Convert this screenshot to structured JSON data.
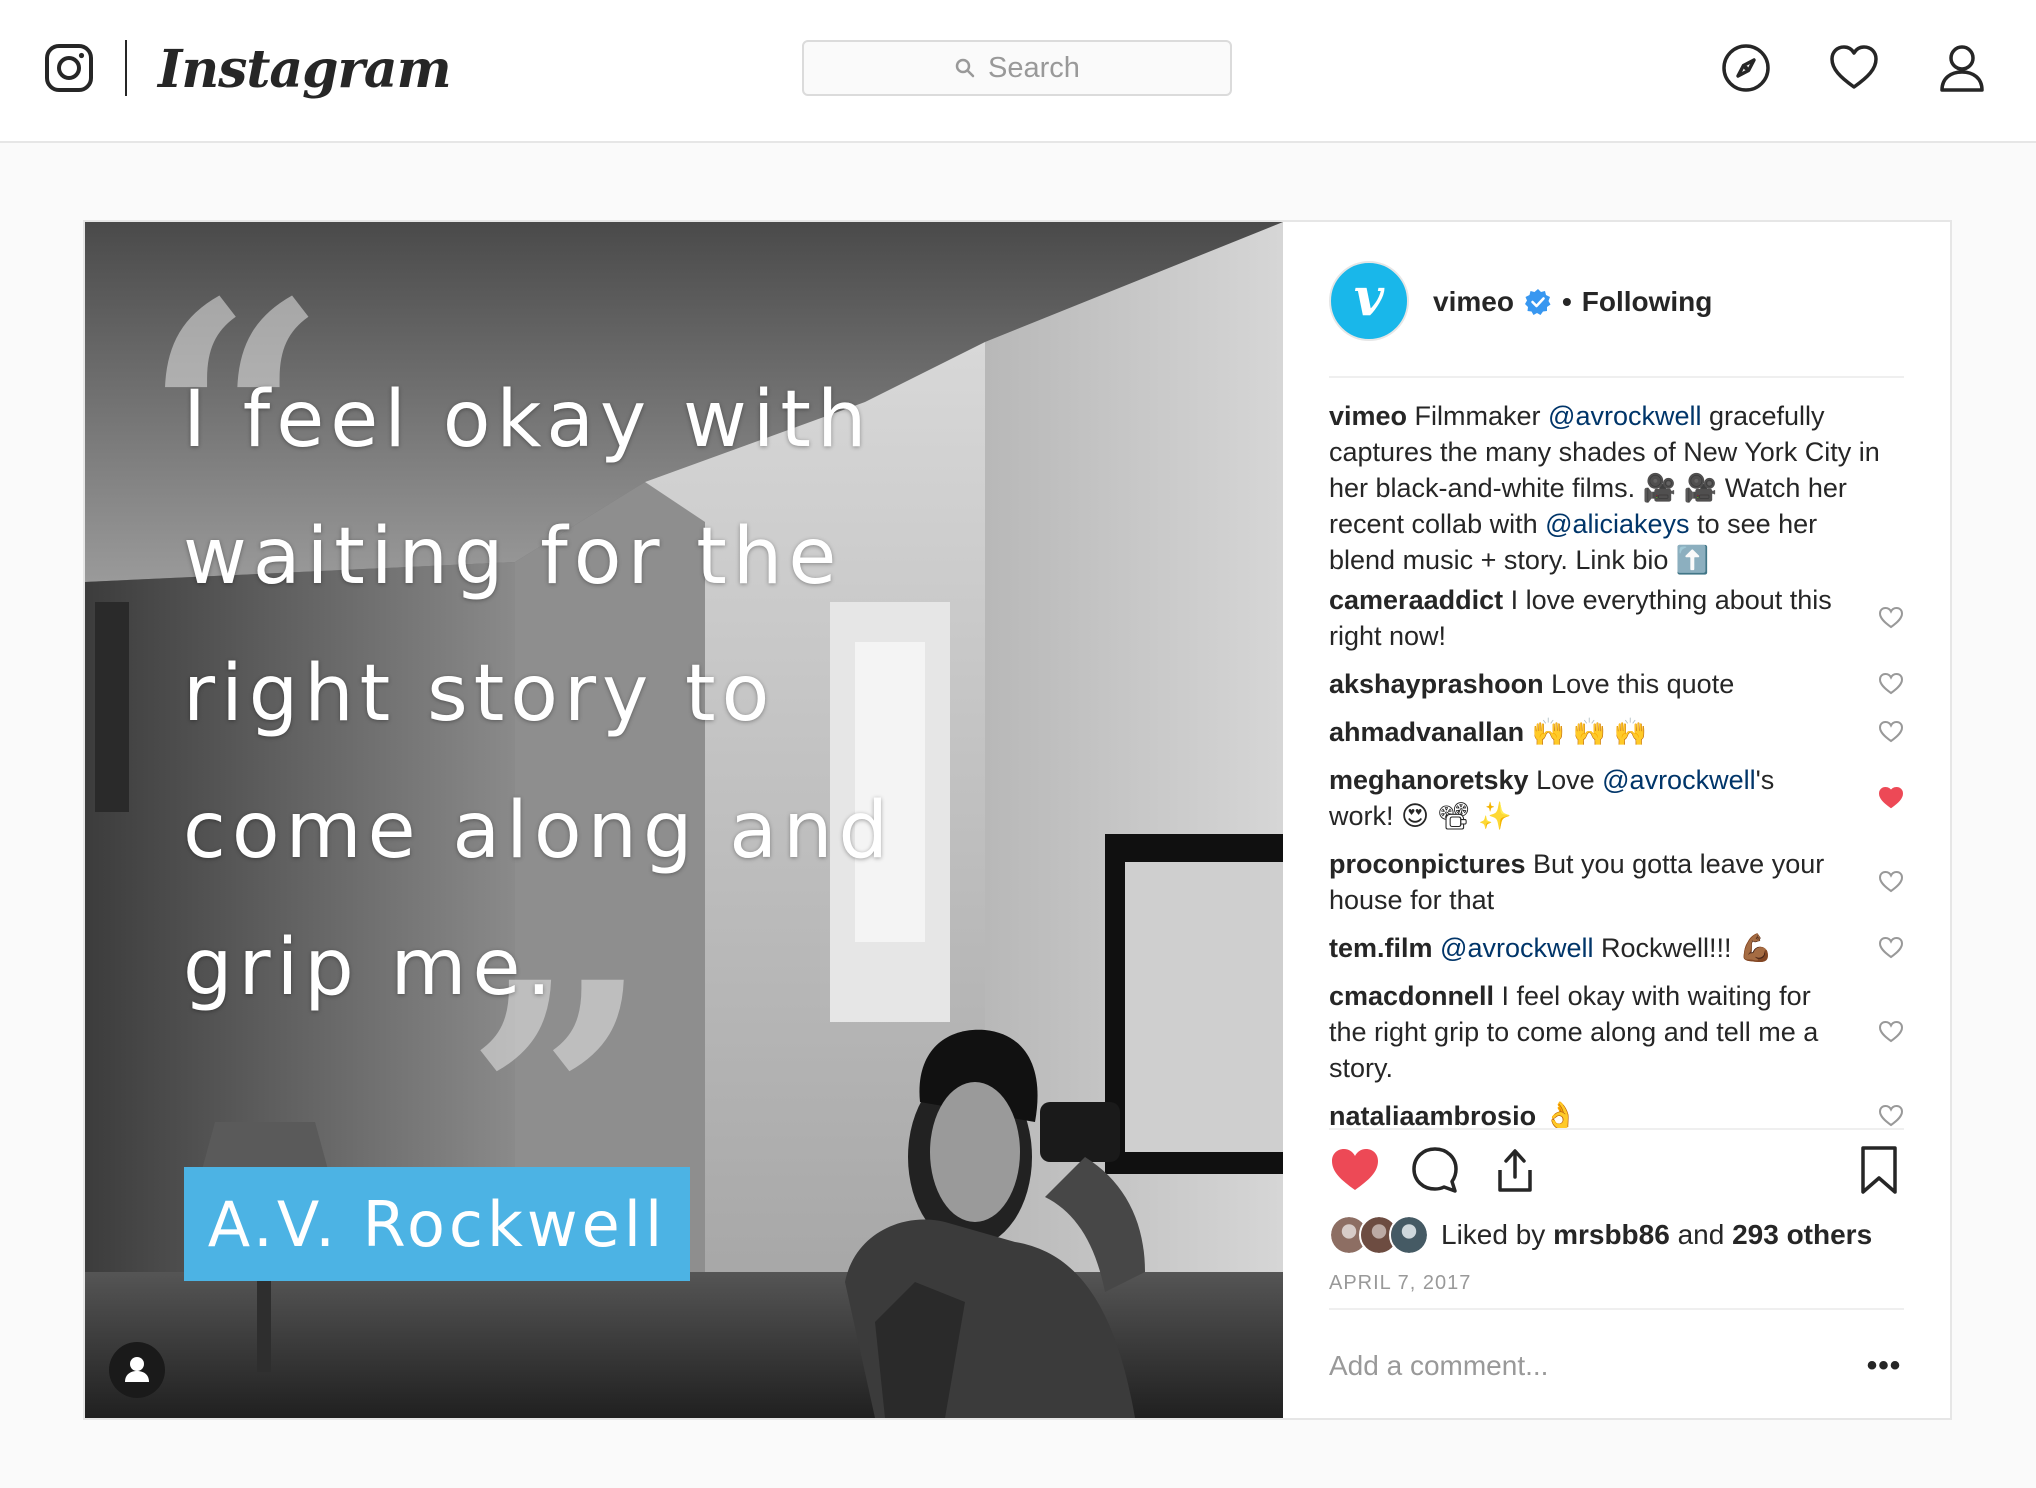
{
  "nav": {
    "brand": "Instagram",
    "search_placeholder": "Search",
    "icons": [
      "instagram-glyph-icon",
      "compass-icon",
      "heart-icon",
      "profile-icon"
    ]
  },
  "post": {
    "media": {
      "quote": "I feel okay with\nwaiting for the\nright story to\ncome along and\ngrip me.",
      "quote_open": "“",
      "quote_close": "”",
      "name_tag": "A.V. Rockwell",
      "name_tag_color": "#4cb3e4"
    },
    "header": {
      "avatar_letter": "v",
      "username": "vimeo",
      "separator": "•",
      "follow_status": "Following",
      "avatar_color": "#19b7ea"
    },
    "caption": {
      "username": "vimeo",
      "text_1": " Filmmaker ",
      "mention_1": "@avrockwell",
      "text_2": " gracefully captures the many shades of New York City in her black-and-white films. 🎥 🎥 Watch her recent collab with ",
      "mention_2": "@aliciakeys",
      "text_3": " to see her blend music + story. Link bio ⬆️"
    },
    "comments": [
      {
        "username": "cameraaddict",
        "text": " I love everything about this right now!",
        "liked": false
      },
      {
        "username": "akshayprashoon",
        "text": " Love this quote",
        "liked": false
      },
      {
        "username": "ahmadvanallan",
        "text": " 🙌 🙌 🙌",
        "liked": false
      },
      {
        "username": "meghanoretsky",
        "text": " Love ",
        "mention": "@avrockwell",
        "text_after": "'s work! 😍 📽 ✨",
        "liked": true
      },
      {
        "username": "proconpictures",
        "text": " But you gotta leave your house for that",
        "liked": false
      },
      {
        "username": "tem.film",
        "text": " ",
        "mention": "@avrockwell",
        "text_after": " Rockwell!!! 💪🏾",
        "liked": false
      },
      {
        "username": "cmacdonnell",
        "text": " I feel okay with waiting for the right grip to come along and tell me a story.",
        "liked": false
      },
      {
        "username": "nataliaambrosio",
        "text": " 👌",
        "liked": false
      }
    ],
    "likes": {
      "prefix": "Liked by ",
      "user": "mrsbb86",
      "middle": " and ",
      "others": "293 others"
    },
    "date": "APRIL 7, 2017",
    "add_comment_placeholder": "Add a comment...",
    "more_label": "•••",
    "post_liked": true,
    "colors": {
      "like_red": "#ed4956",
      "mention_blue": "#003569",
      "verified_blue": "#3897f0"
    }
  }
}
